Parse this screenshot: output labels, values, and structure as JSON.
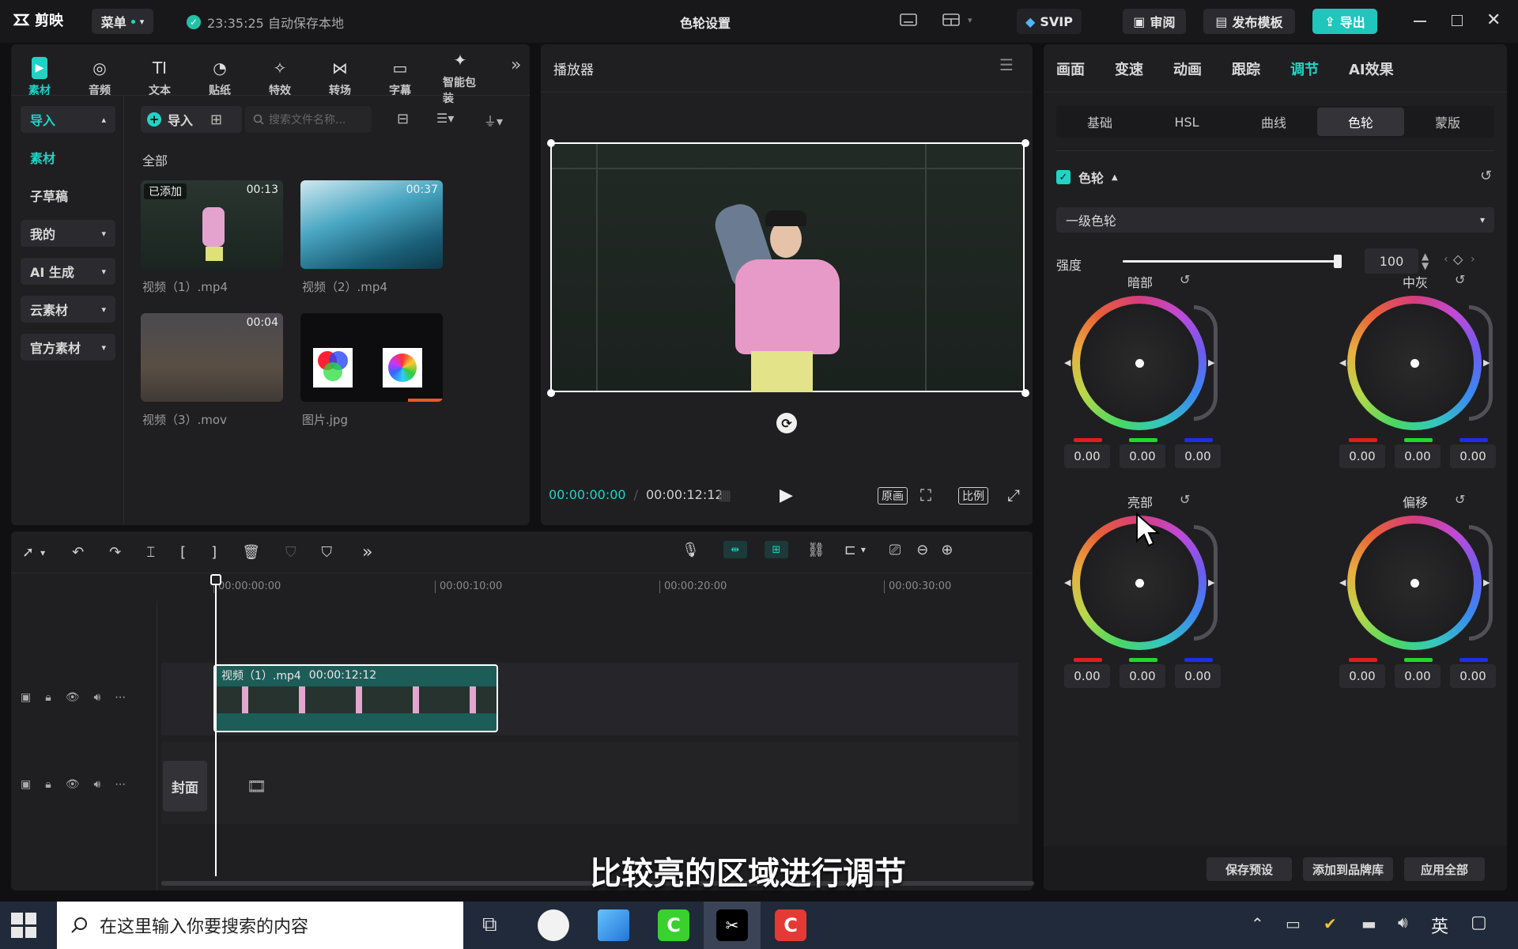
{
  "app": {
    "logo_text": "剪映",
    "menu_label": "菜单",
    "autosave_text": "23:35:25 自动保存本地",
    "window_title": "色轮设置"
  },
  "titlebar": {
    "svip": "SVIP",
    "review": "审阅",
    "publish_template": "发布模板",
    "export": "导出"
  },
  "toolbar_tabs": [
    {
      "label": "素材",
      "icon": "media-icon",
      "active": true
    },
    {
      "label": "音频",
      "icon": "audio-icon"
    },
    {
      "label": "文本",
      "icon": "text-icon"
    },
    {
      "label": "贴纸",
      "icon": "sticker-icon"
    },
    {
      "label": "特效",
      "icon": "effects-icon"
    },
    {
      "label": "转场",
      "icon": "transition-icon"
    },
    {
      "label": "字幕",
      "icon": "subtitle-icon"
    },
    {
      "label": "智能包装",
      "icon": "smart-pack-icon"
    }
  ],
  "sidebar": {
    "items": [
      {
        "label": "导入",
        "active": true,
        "expand": "up"
      },
      {
        "label": "素材",
        "accent": true
      },
      {
        "label": "子草稿"
      },
      {
        "label": "我的",
        "expand": "down"
      },
      {
        "label": "AI 生成",
        "expand": "down"
      },
      {
        "label": "云素材",
        "expand": "down"
      },
      {
        "label": "官方素材",
        "expand": "down"
      }
    ]
  },
  "media": {
    "import_label": "导入",
    "search_placeholder": "搜索文件名称...",
    "section_label": "全部",
    "items": [
      {
        "name": "视频（1）.mp4",
        "badge": "已添加",
        "duration": "00:13"
      },
      {
        "name": "视频（2）.mp4",
        "duration": "00:37"
      },
      {
        "name": "视频（3）.mov",
        "duration": "00:04"
      },
      {
        "name": "图片.jpg"
      }
    ]
  },
  "player": {
    "title": "播放器",
    "current_time": "00:00:00:00",
    "total_time": "00:00:12:12",
    "original_label": "原画",
    "ratio_label": "比例"
  },
  "right_panel": {
    "tabs": [
      "画面",
      "变速",
      "动画",
      "跟踪",
      "调节",
      "AI效果"
    ],
    "active_tab": "调节",
    "subtabs": [
      "基础",
      "HSL",
      "曲线",
      "色轮",
      "蒙版"
    ],
    "active_subtab": "色轮",
    "section_title": "色轮",
    "mode_select": "一级色轮",
    "strength_label": "强度",
    "strength_value": "100",
    "strength_fraction": 1.0,
    "wheels": [
      {
        "label": "暗部",
        "values": [
          "0.00",
          "0.00",
          "0.00"
        ]
      },
      {
        "label": "中灰",
        "values": [
          "0.00",
          "0.00",
          "0.00"
        ]
      },
      {
        "label": "亮部",
        "values": [
          "0.00",
          "0.00",
          "0.00"
        ]
      },
      {
        "label": "偏移",
        "values": [
          "0.00",
          "0.00",
          "0.00"
        ]
      }
    ],
    "footer": {
      "save_preset": "保存预设",
      "add_brand": "添加到品牌库",
      "apply_all": "应用全部"
    }
  },
  "timeline": {
    "ruler": [
      "00:00:00:00",
      "00:00:10:00",
      "00:00:20:00",
      "00:00:30:00"
    ],
    "clip_name": "视频（1）.mp4",
    "clip_duration": "00:00:12:12",
    "cover_label": "封面"
  },
  "subtitle": "比较亮的区域进行调节",
  "taskbar": {
    "search_placeholder": "在这里输入你要搜索的内容",
    "ime": "英"
  },
  "colors": {
    "accent": "#22d3c5",
    "bg": "#101012",
    "panel": "#1f1f22"
  }
}
